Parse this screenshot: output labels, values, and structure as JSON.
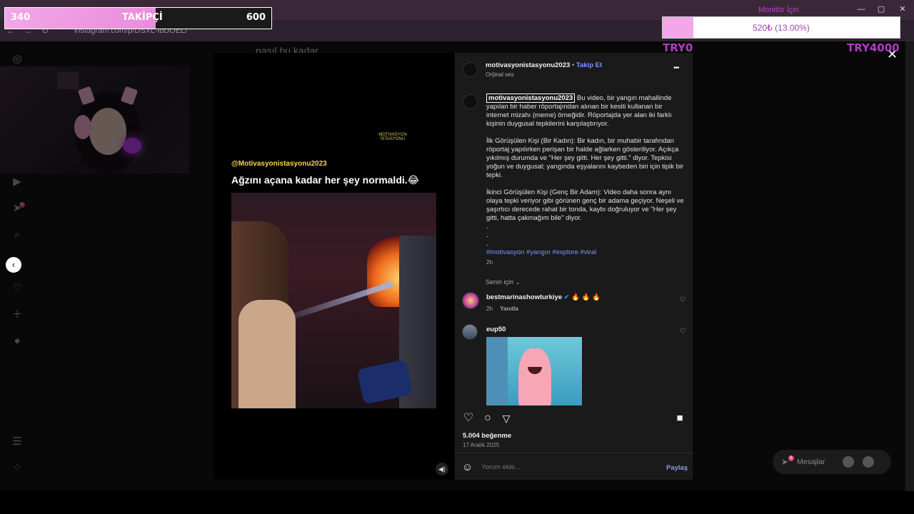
{
  "browser": {
    "url": "instagram.com/p/DSXL-lbDOEL/",
    "window_controls": [
      "—",
      "▢",
      "✕"
    ]
  },
  "overlay": {
    "follow_goal": {
      "current": "340",
      "label": "TAKİPÇİ",
      "target": "600",
      "progress": 0.567
    },
    "monitor": {
      "title": "Monitör İçin",
      "amount_text": "520₺ (13.00%)",
      "progress": 0.13,
      "min_label": "TRY0",
      "max_label": "TRY4000"
    }
  },
  "background": {
    "text": "nasıl bu kadar"
  },
  "sidebar": {
    "icons": [
      "instagram-icon",
      "video-icon",
      "send-icon",
      "search-icon",
      "heart-icon",
      "plus-icon",
      "avatar-icon",
      "menu-icon",
      "apps-icon"
    ],
    "badge": "6"
  },
  "post": {
    "video": {
      "handle": "@Motivasyonistasyonu2023",
      "caption": "Ağzını açana kadar her şey normaldi.😂",
      "logo": "MOTIVASYON İSTASYONU"
    },
    "author": {
      "username": "motivasyonistasyonu2023",
      "follow_label": "Takip Et",
      "audio": "Orijinal ses",
      "more": "•••"
    },
    "description": {
      "paragraph1": "Bu video, bir yangın mahallinde yapılan bir haber röportajından alınan bir kesiti kullanan bir internet mizahı (meme) örneğidir. Röportajda yer alan iki farklı kişinin duygusal tepkilerini karşılaştırıyor.",
      "paragraph2": "İlk Görüşülen Kişi (Bir Kadın): Bir kadın, bir muhabir tarafından röportaj yapılırken perişan bir halde ağlarken gösteriliyor. Açıkça yıkılmış durumda ve \"Her şey gitti. Her şey gitti.\" diyor. Tepkisi yoğun ve duygusal; yangında eşyalarını kaybeden biri için tipik bir tepki.",
      "paragraph3": "İkinci Görüşülen Kişi (Genç Bir Adam): Video daha sonra aynı olaya tepki veriyor gibi görünen genç bir adama geçiyor. Neşeli ve şaşırtıcı derecede rahat bir tonda, kaybı doğruluyor ve \"Her şey gitti, hatta çakmağım bile\" diyor.",
      "dots": ".",
      "hashtags": "#motivasyon #yangın #explore #viral",
      "time": "2h"
    },
    "filter_label": "Senin için",
    "comments": [
      {
        "username": "bestmarinashowturkiye",
        "text": "🔥 🔥 🔥",
        "time": "2h",
        "reply": "Yanıtla"
      },
      {
        "username": "eup50"
      }
    ],
    "likes": "5.004 beğenme",
    "date": "17 Aralık 2025",
    "comment_placeholder": "Yorum ekle...",
    "share_label": "Paylaş"
  },
  "messages": {
    "label": "Mesajlar",
    "badge": "6"
  }
}
